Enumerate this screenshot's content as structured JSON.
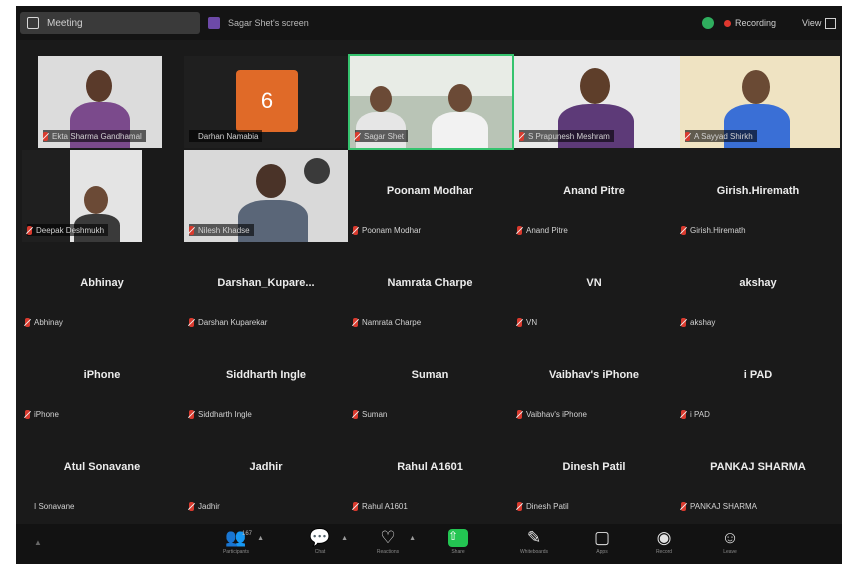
{
  "window": {
    "meeting_tab": "Meeting",
    "other_tab": "Sagar Shet's screen",
    "recording_label": "Recording",
    "view_label": "View"
  },
  "video_tiles": [
    {
      "label": "Ekta Sharma Gandhamal"
    },
    {
      "label": "Darhan Namabia",
      "avatar_letter": "6"
    },
    {
      "label": "Sagar Shet"
    },
    {
      "label": "S Prapunesh Meshram"
    },
    {
      "label": "A Sayyad Shirkh"
    },
    {
      "label": "Deepak Deshmukh"
    },
    {
      "label": "Nilesh Khadse"
    }
  ],
  "name_tiles": [
    {
      "name": "Poonam Modhar",
      "label": "Poonam Modhar",
      "muted": true
    },
    {
      "name": "Anand Pitre",
      "label": "Anand Pitre",
      "muted": true
    },
    {
      "name": "Girish.Hiremath",
      "label": "Girish.Hiremath",
      "muted": true
    },
    {
      "name": "Abhinay",
      "label": "Abhinay",
      "muted": true
    },
    {
      "name": "Darshan_Kupare...",
      "label": "Darshan Kuparekar",
      "muted": true
    },
    {
      "name": "Namrata Charpe",
      "label": "Namrata Charpe",
      "muted": true
    },
    {
      "name": "VN",
      "label": "VN",
      "muted": true
    },
    {
      "name": "akshay",
      "label": "akshay",
      "muted": true
    },
    {
      "name": "iPhone",
      "label": "iPhone",
      "muted": true
    },
    {
      "name": "Siddharth Ingle",
      "label": "Siddharth Ingle",
      "muted": true
    },
    {
      "name": "Suman",
      "label": "Suman",
      "muted": true
    },
    {
      "name": "Vaibhav's iPhone",
      "label": "Vaibhav's iPhone",
      "muted": true
    },
    {
      "name": "i PAD",
      "label": "i PAD",
      "muted": true
    },
    {
      "name": "Atul Sonavane",
      "label": "I Sonavane",
      "muted": false
    },
    {
      "name": "Jadhir",
      "label": "Jadhir",
      "muted": true
    },
    {
      "name": "Rahul A1601",
      "label": "Rahul A1601",
      "muted": true
    },
    {
      "name": "Dinesh Patil",
      "label": "Dinesh Patil",
      "muted": true
    },
    {
      "name": "PANKAJ SHARMA",
      "label": "PANKAJ SHARMA",
      "muted": true
    }
  ],
  "toolbar": {
    "participants_label": "Participants",
    "participants_count": "167",
    "chat_label": "Chat",
    "reactions_label": "Reactions",
    "share_label": "Share",
    "whiteboard_label": "Whiteboards",
    "apps_label": "Apps",
    "record_label": "Record",
    "leave_label": "Leave"
  },
  "colors": {
    "background": "#1a1a1a",
    "muted_mic": "#d93a2e",
    "share_green": "#23c552",
    "avatar_orange": "#e06a28",
    "active_speaker": "#35c36e"
  }
}
